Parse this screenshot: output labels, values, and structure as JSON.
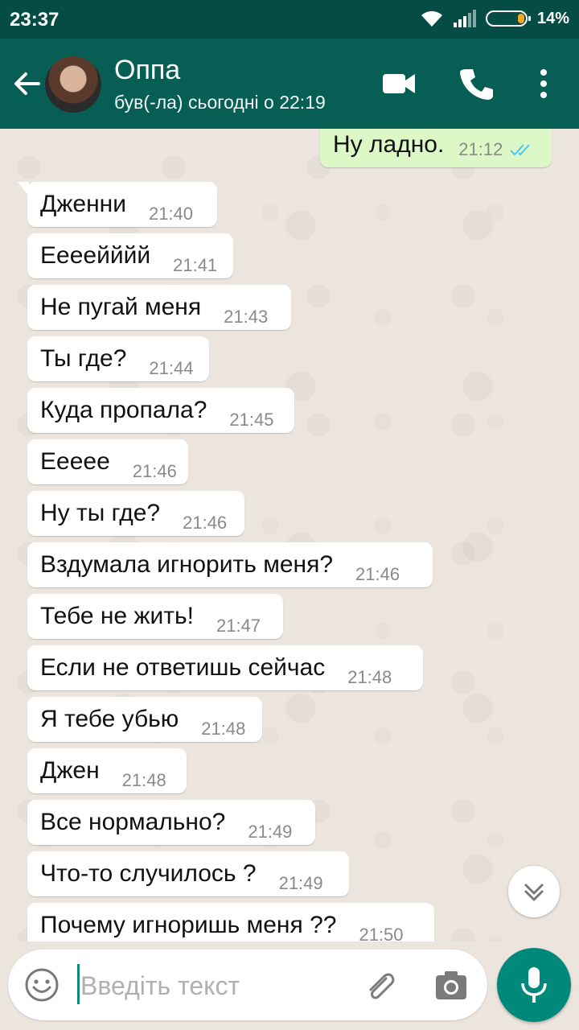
{
  "status_bar": {
    "time": "23:37",
    "battery": "14%",
    "battery_level": 0.14
  },
  "header": {
    "contact_name": "Оппа",
    "last_seen": "був(-ла) сьогодні о 22:19",
    "icons": [
      "back-arrow-icon",
      "video-call-icon",
      "phone-icon",
      "more-vert-icon"
    ]
  },
  "messages": {
    "outgoing": {
      "text": "Ну ладно.",
      "time": "21:12"
    },
    "incoming": [
      {
        "text": "Дженни",
        "time": "21:40"
      },
      {
        "text": "Eeeeйййй",
        "time": "21:41"
      },
      {
        "text": "Не пугай меня",
        "time": "21:43"
      },
      {
        "text": "Ты где?",
        "time": "21:44"
      },
      {
        "text": "Куда пропала?",
        "time": "21:45"
      },
      {
        "text": "Еееее",
        "time": "21:46"
      },
      {
        "text": "Ну ты где?",
        "time": "21:46"
      },
      {
        "text": "Вздумала игнорить меня?",
        "time": "21:46"
      },
      {
        "text": "Тебе не жить!",
        "time": "21:47"
      },
      {
        "text": "Если не ответишь сейчас",
        "time": "21:48"
      },
      {
        "text": "Я тебе убью",
        "time": "21:48"
      },
      {
        "text": "Джен",
        "time": "21:48"
      },
      {
        "text": "Все нормально?",
        "time": "21:49"
      },
      {
        "text": "Что-то случилось ?",
        "time": "21:49"
      },
      {
        "text": "Почему игноришь меня ??",
        "time": "21:50"
      }
    ]
  },
  "composer": {
    "placeholder": "Введіть текст",
    "value": ""
  },
  "colors": {
    "header": "#075e54",
    "status_bar": "#054d44",
    "outgoing_bubble": "#dcf8c6",
    "accent": "#00897b",
    "read_ticks": "#4fc3f7"
  }
}
